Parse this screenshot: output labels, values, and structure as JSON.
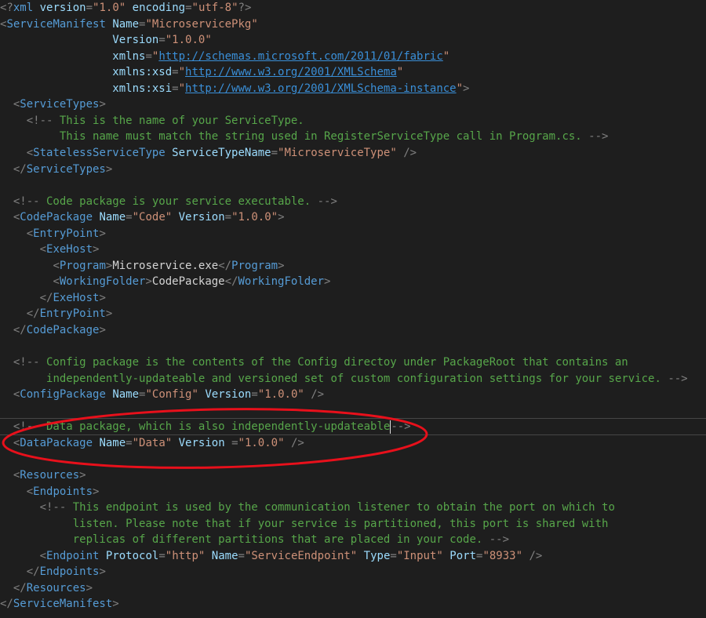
{
  "editor": {
    "lines": [
      {
        "indent": "",
        "tokens": [
          {
            "c": "p",
            "t": "<?"
          },
          {
            "c": "t",
            "t": "xml"
          },
          {
            "c": "x",
            "t": " "
          },
          {
            "c": "a",
            "t": "version"
          },
          {
            "c": "p",
            "t": "="
          },
          {
            "c": "s",
            "t": "\"1.0\""
          },
          {
            "c": "x",
            "t": " "
          },
          {
            "c": "a",
            "t": "encoding"
          },
          {
            "c": "p",
            "t": "="
          },
          {
            "c": "s",
            "t": "\"utf-8\""
          },
          {
            "c": "p",
            "t": "?>"
          }
        ]
      },
      {
        "indent": "",
        "tokens": [
          {
            "c": "p",
            "t": "<"
          },
          {
            "c": "t",
            "t": "ServiceManifest"
          },
          {
            "c": "x",
            "t": " "
          },
          {
            "c": "a",
            "t": "Name"
          },
          {
            "c": "p",
            "t": "="
          },
          {
            "c": "s",
            "t": "\"MicroservicePkg\""
          }
        ]
      },
      {
        "indent": "                 ",
        "tokens": [
          {
            "c": "a",
            "t": "Version"
          },
          {
            "c": "p",
            "t": "="
          },
          {
            "c": "s",
            "t": "\"1.0.0\""
          }
        ]
      },
      {
        "indent": "                 ",
        "tokens": [
          {
            "c": "a",
            "t": "xmlns"
          },
          {
            "c": "p",
            "t": "="
          },
          {
            "c": "s",
            "t": "\""
          },
          {
            "c": "u",
            "t": "http://schemas.microsoft.com/2011/01/fabric"
          },
          {
            "c": "s",
            "t": "\""
          }
        ]
      },
      {
        "indent": "                 ",
        "tokens": [
          {
            "c": "a",
            "t": "xmlns:xsd"
          },
          {
            "c": "p",
            "t": "="
          },
          {
            "c": "s",
            "t": "\""
          },
          {
            "c": "u",
            "t": "http://www.w3.org/2001/XMLSchema"
          },
          {
            "c": "s",
            "t": "\""
          }
        ]
      },
      {
        "indent": "                 ",
        "tokens": [
          {
            "c": "a",
            "t": "xmlns:xsi"
          },
          {
            "c": "p",
            "t": "="
          },
          {
            "c": "s",
            "t": "\""
          },
          {
            "c": "u",
            "t": "http://www.w3.org/2001/XMLSchema-instance"
          },
          {
            "c": "s",
            "t": "\""
          },
          {
            "c": "p",
            "t": ">"
          }
        ]
      },
      {
        "indent": "  ",
        "tokens": [
          {
            "c": "p",
            "t": "<"
          },
          {
            "c": "t",
            "t": "ServiceTypes"
          },
          {
            "c": "p",
            "t": ">"
          }
        ]
      },
      {
        "indent": "    ",
        "tokens": [
          {
            "c": "p",
            "t": "<!--"
          },
          {
            "c": "c",
            "t": " This is the name of your ServiceType."
          }
        ]
      },
      {
        "indent": "         ",
        "tokens": [
          {
            "c": "c",
            "t": "This name must match the string used in RegisterServiceType call in Program.cs. "
          },
          {
            "c": "p",
            "t": "-->"
          }
        ]
      },
      {
        "indent": "    ",
        "tokens": [
          {
            "c": "p",
            "t": "<"
          },
          {
            "c": "t",
            "t": "StatelessServiceType"
          },
          {
            "c": "x",
            "t": " "
          },
          {
            "c": "a",
            "t": "ServiceTypeName"
          },
          {
            "c": "p",
            "t": "="
          },
          {
            "c": "s",
            "t": "\"MicroserviceType\""
          },
          {
            "c": "x",
            "t": " "
          },
          {
            "c": "p",
            "t": "/>"
          }
        ]
      },
      {
        "indent": "  ",
        "tokens": [
          {
            "c": "p",
            "t": "</"
          },
          {
            "c": "t",
            "t": "ServiceTypes"
          },
          {
            "c": "p",
            "t": ">"
          }
        ]
      },
      {
        "indent": "",
        "tokens": []
      },
      {
        "indent": "  ",
        "tokens": [
          {
            "c": "p",
            "t": "<!--"
          },
          {
            "c": "c",
            "t": " Code package is your service executable. "
          },
          {
            "c": "p",
            "t": "-->"
          }
        ]
      },
      {
        "indent": "  ",
        "tokens": [
          {
            "c": "p",
            "t": "<"
          },
          {
            "c": "t",
            "t": "CodePackage"
          },
          {
            "c": "x",
            "t": " "
          },
          {
            "c": "a",
            "t": "Name"
          },
          {
            "c": "p",
            "t": "="
          },
          {
            "c": "s",
            "t": "\"Code\""
          },
          {
            "c": "x",
            "t": " "
          },
          {
            "c": "a",
            "t": "Version"
          },
          {
            "c": "p",
            "t": "="
          },
          {
            "c": "s",
            "t": "\"1.0.0\""
          },
          {
            "c": "p",
            "t": ">"
          }
        ]
      },
      {
        "indent": "    ",
        "tokens": [
          {
            "c": "p",
            "t": "<"
          },
          {
            "c": "t",
            "t": "EntryPoint"
          },
          {
            "c": "p",
            "t": ">"
          }
        ]
      },
      {
        "indent": "      ",
        "tokens": [
          {
            "c": "p",
            "t": "<"
          },
          {
            "c": "t",
            "t": "ExeHost"
          },
          {
            "c": "p",
            "t": ">"
          }
        ]
      },
      {
        "indent": "        ",
        "tokens": [
          {
            "c": "p",
            "t": "<"
          },
          {
            "c": "t",
            "t": "Program"
          },
          {
            "c": "p",
            "t": ">"
          },
          {
            "c": "x",
            "t": "Microservice.exe"
          },
          {
            "c": "p",
            "t": "</"
          },
          {
            "c": "t",
            "t": "Program"
          },
          {
            "c": "p",
            "t": ">"
          }
        ]
      },
      {
        "indent": "        ",
        "tokens": [
          {
            "c": "p",
            "t": "<"
          },
          {
            "c": "t",
            "t": "WorkingFolder"
          },
          {
            "c": "p",
            "t": ">"
          },
          {
            "c": "x",
            "t": "CodePackage"
          },
          {
            "c": "p",
            "t": "</"
          },
          {
            "c": "t",
            "t": "WorkingFolder"
          },
          {
            "c": "p",
            "t": ">"
          }
        ]
      },
      {
        "indent": "      ",
        "tokens": [
          {
            "c": "p",
            "t": "</"
          },
          {
            "c": "t",
            "t": "ExeHost"
          },
          {
            "c": "p",
            "t": ">"
          }
        ]
      },
      {
        "indent": "    ",
        "tokens": [
          {
            "c": "p",
            "t": "</"
          },
          {
            "c": "t",
            "t": "EntryPoint"
          },
          {
            "c": "p",
            "t": ">"
          }
        ]
      },
      {
        "indent": "  ",
        "tokens": [
          {
            "c": "p",
            "t": "</"
          },
          {
            "c": "t",
            "t": "CodePackage"
          },
          {
            "c": "p",
            "t": ">"
          }
        ]
      },
      {
        "indent": "",
        "tokens": []
      },
      {
        "indent": "  ",
        "tokens": [
          {
            "c": "p",
            "t": "<!--"
          },
          {
            "c": "c",
            "t": " Config package is the contents of the Config directoy under PackageRoot that contains an"
          }
        ]
      },
      {
        "indent": "       ",
        "tokens": [
          {
            "c": "c",
            "t": "independently-updateable and versioned set of custom configuration settings for your service. "
          },
          {
            "c": "p",
            "t": "-->"
          }
        ]
      },
      {
        "indent": "  ",
        "tokens": [
          {
            "c": "p",
            "t": "<"
          },
          {
            "c": "t",
            "t": "ConfigPackage"
          },
          {
            "c": "x",
            "t": " "
          },
          {
            "c": "a",
            "t": "Name"
          },
          {
            "c": "p",
            "t": "="
          },
          {
            "c": "s",
            "t": "\"Config\""
          },
          {
            "c": "x",
            "t": " "
          },
          {
            "c": "a",
            "t": "Version"
          },
          {
            "c": "p",
            "t": "="
          },
          {
            "c": "s",
            "t": "\"1.0.0\""
          },
          {
            "c": "x",
            "t": " "
          },
          {
            "c": "p",
            "t": "/>"
          }
        ]
      },
      {
        "indent": "",
        "tokens": []
      },
      {
        "indent": "  ",
        "tokens": [
          {
            "c": "p",
            "t": "<!--"
          },
          {
            "c": "c",
            "t": " Data package, which is also independently-updateable"
          },
          {
            "c": "p",
            "t": "-->"
          }
        ]
      },
      {
        "indent": "  ",
        "tokens": [
          {
            "c": "p",
            "t": "<"
          },
          {
            "c": "t",
            "t": "DataPackage"
          },
          {
            "c": "x",
            "t": " "
          },
          {
            "c": "a",
            "t": "Name"
          },
          {
            "c": "p",
            "t": "="
          },
          {
            "c": "s",
            "t": "\"Data\""
          },
          {
            "c": "x",
            "t": " "
          },
          {
            "c": "a",
            "t": "Version"
          },
          {
            "c": "x",
            "t": " "
          },
          {
            "c": "p",
            "t": "="
          },
          {
            "c": "s",
            "t": "\"1.0.0\""
          },
          {
            "c": "x",
            "t": " "
          },
          {
            "c": "p",
            "t": "/>"
          }
        ]
      },
      {
        "indent": "",
        "tokens": []
      },
      {
        "indent": "  ",
        "tokens": [
          {
            "c": "p",
            "t": "<"
          },
          {
            "c": "t",
            "t": "Resources"
          },
          {
            "c": "p",
            "t": ">"
          }
        ]
      },
      {
        "indent": "    ",
        "tokens": [
          {
            "c": "p",
            "t": "<"
          },
          {
            "c": "t",
            "t": "Endpoints"
          },
          {
            "c": "p",
            "t": ">"
          }
        ]
      },
      {
        "indent": "      ",
        "tokens": [
          {
            "c": "p",
            "t": "<!--"
          },
          {
            "c": "c",
            "t": " This endpoint is used by the communication listener to obtain the port on which to"
          }
        ]
      },
      {
        "indent": "           ",
        "tokens": [
          {
            "c": "c",
            "t": "listen. Please note that if your service is partitioned, this port is shared with"
          }
        ]
      },
      {
        "indent": "           ",
        "tokens": [
          {
            "c": "c",
            "t": "replicas of different partitions that are placed in your code. "
          },
          {
            "c": "p",
            "t": "-->"
          }
        ]
      },
      {
        "indent": "      ",
        "tokens": [
          {
            "c": "p",
            "t": "<"
          },
          {
            "c": "t",
            "t": "Endpoint"
          },
          {
            "c": "x",
            "t": " "
          },
          {
            "c": "a",
            "t": "Protocol"
          },
          {
            "c": "p",
            "t": "="
          },
          {
            "c": "s",
            "t": "\"http\""
          },
          {
            "c": "x",
            "t": " "
          },
          {
            "c": "a",
            "t": "Name"
          },
          {
            "c": "p",
            "t": "="
          },
          {
            "c": "s",
            "t": "\"ServiceEndpoint\""
          },
          {
            "c": "x",
            "t": " "
          },
          {
            "c": "a",
            "t": "Type"
          },
          {
            "c": "p",
            "t": "="
          },
          {
            "c": "s",
            "t": "\"Input\""
          },
          {
            "c": "x",
            "t": " "
          },
          {
            "c": "a",
            "t": "Port"
          },
          {
            "c": "p",
            "t": "="
          },
          {
            "c": "s",
            "t": "\"8933\""
          },
          {
            "c": "x",
            "t": " "
          },
          {
            "c": "p",
            "t": "/>"
          }
        ]
      },
      {
        "indent": "    ",
        "tokens": [
          {
            "c": "p",
            "t": "</"
          },
          {
            "c": "t",
            "t": "Endpoints"
          },
          {
            "c": "p",
            "t": ">"
          }
        ]
      },
      {
        "indent": "  ",
        "tokens": [
          {
            "c": "p",
            "t": "</"
          },
          {
            "c": "t",
            "t": "Resources"
          },
          {
            "c": "p",
            "t": ">"
          }
        ]
      },
      {
        "indent": "",
        "tokens": [
          {
            "c": "p",
            "t": "</"
          },
          {
            "c": "t",
            "t": "ServiceManifest"
          },
          {
            "c": "p",
            "t": ">"
          }
        ]
      }
    ],
    "current_line": 26
  },
  "colors": {
    "background": "#1e1e1e",
    "highlight_ellipse": "#e8101b"
  }
}
